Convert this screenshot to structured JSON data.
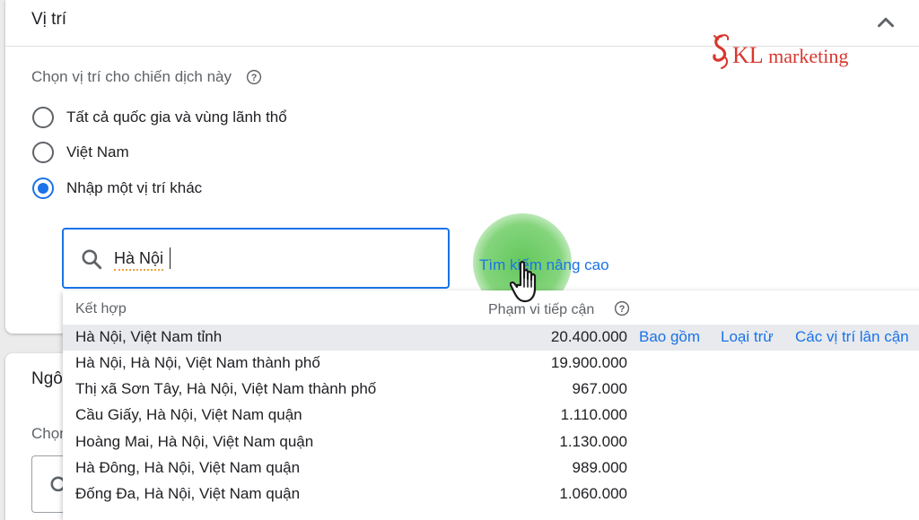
{
  "panel": {
    "title": "Vị trí",
    "section_label": "Chọn vị trí cho chiến dịch này"
  },
  "logo": {
    "initial": "S",
    "big": "KL",
    "text": " marketing"
  },
  "radios": [
    {
      "label": "Tất cả quốc gia và vùng lãnh thổ",
      "checked": false
    },
    {
      "label": "Việt Nam",
      "checked": false
    },
    {
      "label": "Nhập một vị trí khác",
      "checked": true
    }
  ],
  "search": {
    "value": "Hà Nội",
    "advanced_link": "Tìm kiếm nâng cao"
  },
  "dropdown": {
    "col_match": "Kết hợp",
    "col_reach": "Phạm vi tiếp cận",
    "actions": {
      "include": "Bao gồm",
      "exclude": "Loại trừ",
      "nearby": "Các vị trí lân cận"
    },
    "rows": [
      {
        "name": "Hà Nội, Việt Nam tỉnh",
        "reach": "20.400.000"
      },
      {
        "name": "Hà Nội, Hà Nội, Việt Nam thành phố",
        "reach": "19.900.000"
      },
      {
        "name": "Thị xã Sơn Tây, Hà Nội, Việt Nam thành phố",
        "reach": "967.000"
      },
      {
        "name": "Cầu Giấy, Hà Nội, Việt Nam quận",
        "reach": "1.110.000"
      },
      {
        "name": "Hoàng Mai, Hà Nội, Việt Nam quận",
        "reach": "1.130.000"
      },
      {
        "name": "Hà Đông, Hà Nội, Việt Nam quận",
        "reach": "989.000"
      },
      {
        "name": "Đống Đa, Hà Nội, Việt Nam quận",
        "reach": "1.060.000"
      }
    ]
  },
  "second_panel": {
    "title": "Ngô",
    "label": "Chọn"
  },
  "colors": {
    "accent": "#1a73e8",
    "logo": "#d7372f",
    "highlight": "#e8eaed",
    "click_glow": "#56c34e"
  },
  "icons": [
    "chevron-up-icon",
    "help-icon",
    "search-icon",
    "hand-cursor-icon",
    "dragon-logo-icon"
  ]
}
